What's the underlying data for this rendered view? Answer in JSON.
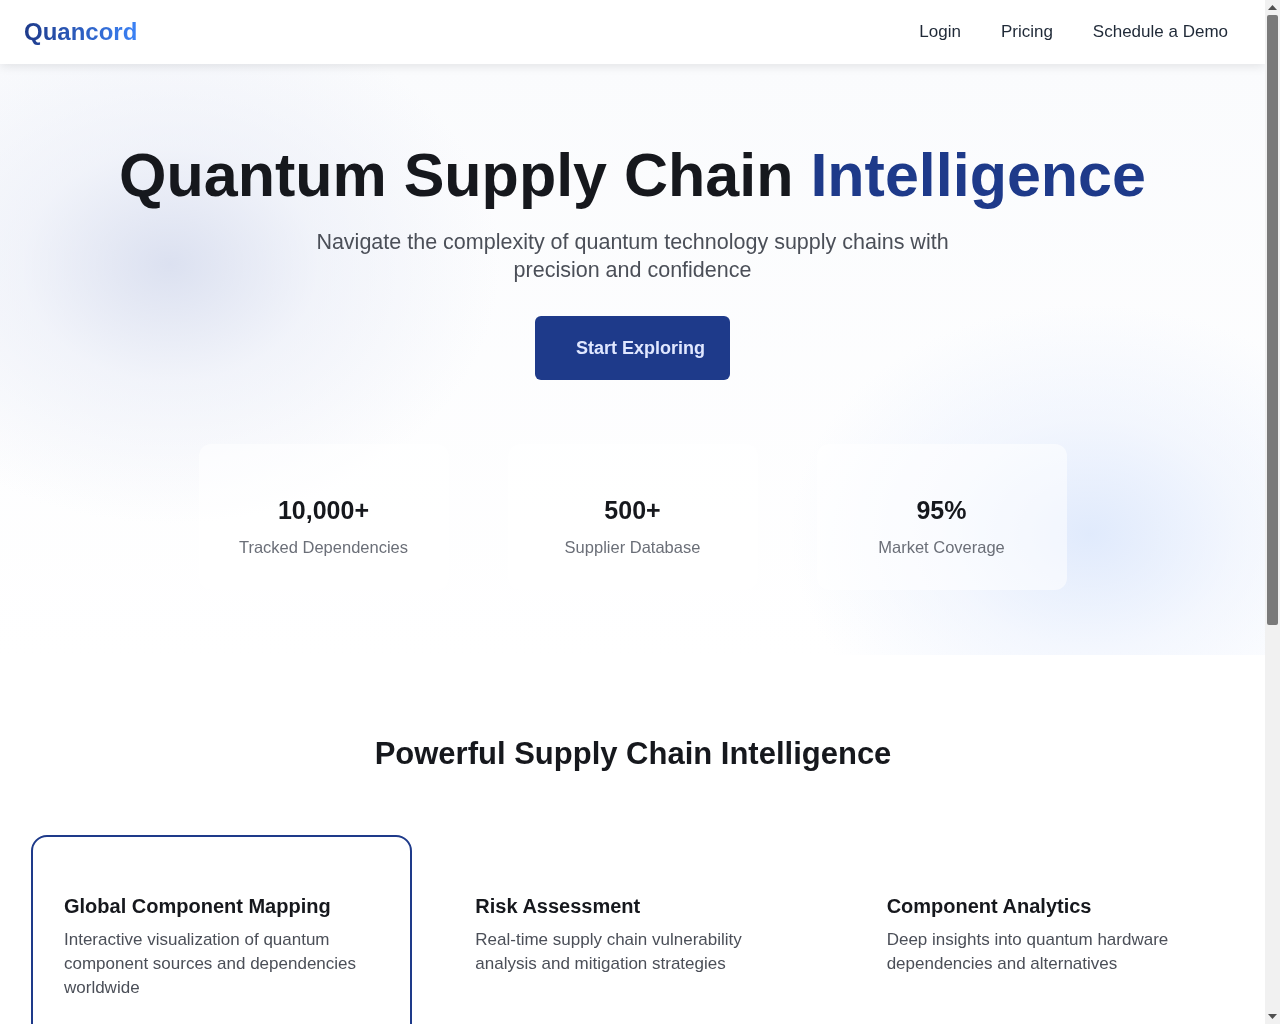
{
  "header": {
    "logo": "Quancord",
    "nav": [
      {
        "label": "Login"
      },
      {
        "label": "Pricing"
      },
      {
        "label": "Schedule a Demo"
      }
    ]
  },
  "hero": {
    "title": "Quantum Supply Chain",
    "title_highlight": "Intelligence",
    "subtitle": "Navigate the complexity of quantum technology supply chains with precision and confidence",
    "cta": "Start Exploring"
  },
  "stats": [
    {
      "value": "10,000+",
      "label": "Tracked Dependencies"
    },
    {
      "value": "500+",
      "label": "Supplier Database"
    },
    {
      "value": "95%",
      "label": "Market Coverage"
    }
  ],
  "features": {
    "heading": "Powerful Supply Chain Intelligence",
    "cards": [
      {
        "title": "Global Component Mapping",
        "description": "Interactive visualization of quantum component sources and dependencies worldwide",
        "selected": true
      },
      {
        "title": "Risk Assessment",
        "description": "Real-time supply chain vulnerability analysis and mitigation strategies",
        "selected": false
      },
      {
        "title": "Component Analytics",
        "description": "Deep insights into quantum hardware dependencies and alternatives",
        "selected": false
      }
    ]
  }
}
